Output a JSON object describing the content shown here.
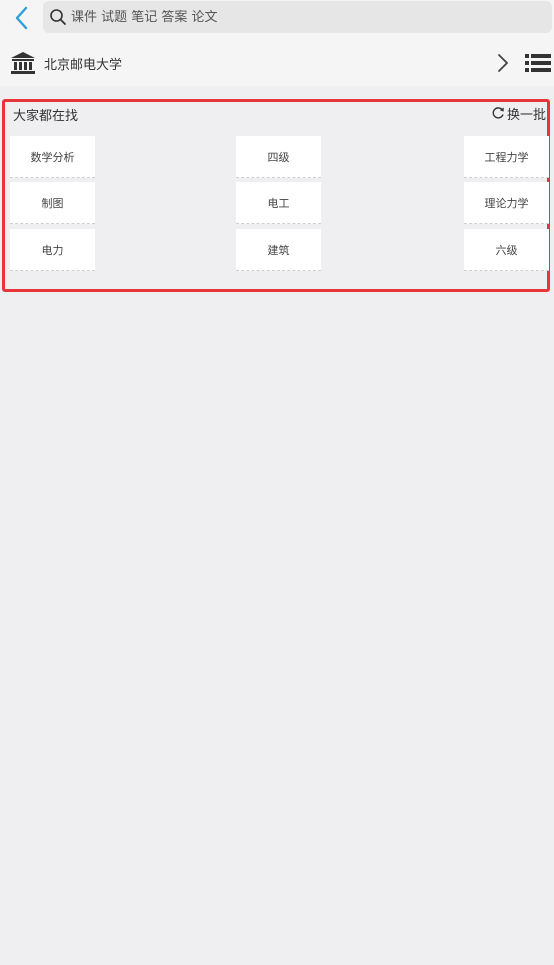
{
  "search": {
    "placeholder": "课件 试题 笔记 答案 论文"
  },
  "school": {
    "name": "北京邮电大学"
  },
  "hot": {
    "title": "大家都在找",
    "refresh_label": "换一批",
    "tags": [
      "数学分析",
      "四级",
      "工程力学",
      "制图",
      "电工",
      "理论力学",
      "电力",
      "建筑",
      "六级"
    ]
  },
  "colors": {
    "accent": "#2e9fd8",
    "highlight_border": "#e8353b",
    "background": "#efeff1"
  },
  "icons": [
    "back-arrow-icon",
    "search-icon",
    "school-building-icon",
    "chevron-right-icon",
    "list-icon",
    "refresh-icon"
  ]
}
